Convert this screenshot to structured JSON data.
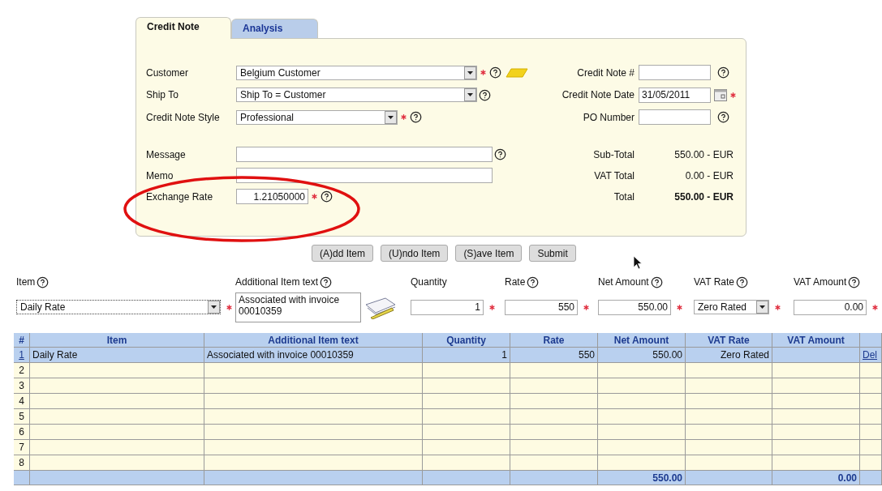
{
  "tabs": [
    {
      "label": "Credit Note",
      "selected": true
    },
    {
      "label": "Analysis",
      "selected": false
    }
  ],
  "header_fields": [
    {
      "label": "Customer",
      "kind": "wide_select",
      "value": "Belgium Customer",
      "required": true,
      "help": true,
      "lookup": true
    },
    {
      "label": "Ship To",
      "kind": "wide_select",
      "value": "Ship To = Customer",
      "required": false,
      "help": true,
      "lookup": false
    },
    {
      "label": "Credit Note Style",
      "kind": "select",
      "value": "Professional",
      "required": true,
      "help": true,
      "lookup": false
    }
  ],
  "side_fields": [
    {
      "label": "Credit Note #",
      "required": false,
      "help": true,
      "calendar": false
    },
    {
      "label": "Credit Note Date",
      "value": "31/05/2011",
      "required": true,
      "help": false,
      "calendar": true
    },
    {
      "label": "PO Number",
      "required": false,
      "help": true,
      "calendar": false
    }
  ],
  "note_fields": [
    {
      "label": "Message",
      "kind": "wide_text",
      "required": false,
      "help": true
    },
    {
      "label": "Memo",
      "kind": "wide_text",
      "required": false,
      "help": false
    },
    {
      "label": "Exchange Rate",
      "kind": "number",
      "value": "1.21050000",
      "required": true,
      "help": true
    }
  ],
  "totals": [
    {
      "label": "Sub-Total",
      "value": "550.00 - EUR",
      "kind": "sub"
    },
    {
      "label": "VAT Total",
      "value": "0.00 - EUR",
      "kind": "sub"
    },
    {
      "label": "Total",
      "value": "550.00 - EUR",
      "kind": "grand"
    }
  ],
  "buttons": [
    "(A)dd Item",
    "(U)ndo Item",
    "(S)ave Item",
    "Submit"
  ],
  "item_entry": [
    {
      "label": "Item",
      "help": true,
      "kind": "select",
      "value": "Daily Rate",
      "required": true
    },
    {
      "label": "Additional Item text",
      "help": true,
      "kind": "textarea",
      "value": "Associated with invoice 00010359",
      "required": false
    },
    {
      "label": "Quantity",
      "help": false,
      "kind": "number",
      "value": "1",
      "required": true
    },
    {
      "label": "Rate",
      "help": true,
      "kind": "number",
      "value": "550",
      "required": true
    },
    {
      "label": "Net Amount",
      "help": true,
      "kind": "number",
      "value": "550.00",
      "required": true
    },
    {
      "label": "VAT Rate",
      "help": true,
      "kind": "small_select",
      "value": "Zero Rated",
      "required": true
    },
    {
      "label": "VAT Amount",
      "help": true,
      "kind": "number",
      "value": "0.00",
      "required": true
    }
  ],
  "table": {
    "columns": [
      "#",
      "Item",
      "Additional Item text",
      "Quantity",
      "Rate",
      "Net Amount",
      "VAT Rate",
      "VAT Amount"
    ],
    "rows": [
      {
        "number": "1",
        "item": "Daily Rate",
        "text": "Associated with invoice 00010359",
        "quantity": "1",
        "rate": "550",
        "net": "550.00",
        "vat_rate": "Zero Rated",
        "action": "Del",
        "selected": true
      },
      {
        "number": "2",
        "selected": false
      },
      {
        "number": "3",
        "selected": false
      },
      {
        "number": "4",
        "selected": false
      },
      {
        "number": "5",
        "selected": false
      },
      {
        "number": "6",
        "selected": false
      },
      {
        "number": "7",
        "selected": false
      },
      {
        "number": "8",
        "selected": false
      }
    ],
    "footer": {
      "net": "550.00",
      "vat_amount": "0.00"
    }
  }
}
